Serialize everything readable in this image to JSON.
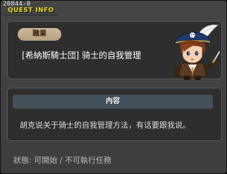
{
  "quest": {
    "id": "20844-0",
    "window_title": "QUEST INFO"
  },
  "job": {
    "badge_label": "職業",
    "name": "[希納斯騎士団] 骑士的自我管理"
  },
  "npc": {
    "icon": "captain-npc-portrait"
  },
  "content": {
    "header": "內容",
    "text": "胡克说关于骑士的自我管理方法，有话要跟我说。"
  },
  "status": {
    "text": "狀態: 可開始 / 不可執行任務"
  },
  "colors": {
    "title": "#f2e21a",
    "badge": "#cdbb9e",
    "content_header": "#455058"
  }
}
